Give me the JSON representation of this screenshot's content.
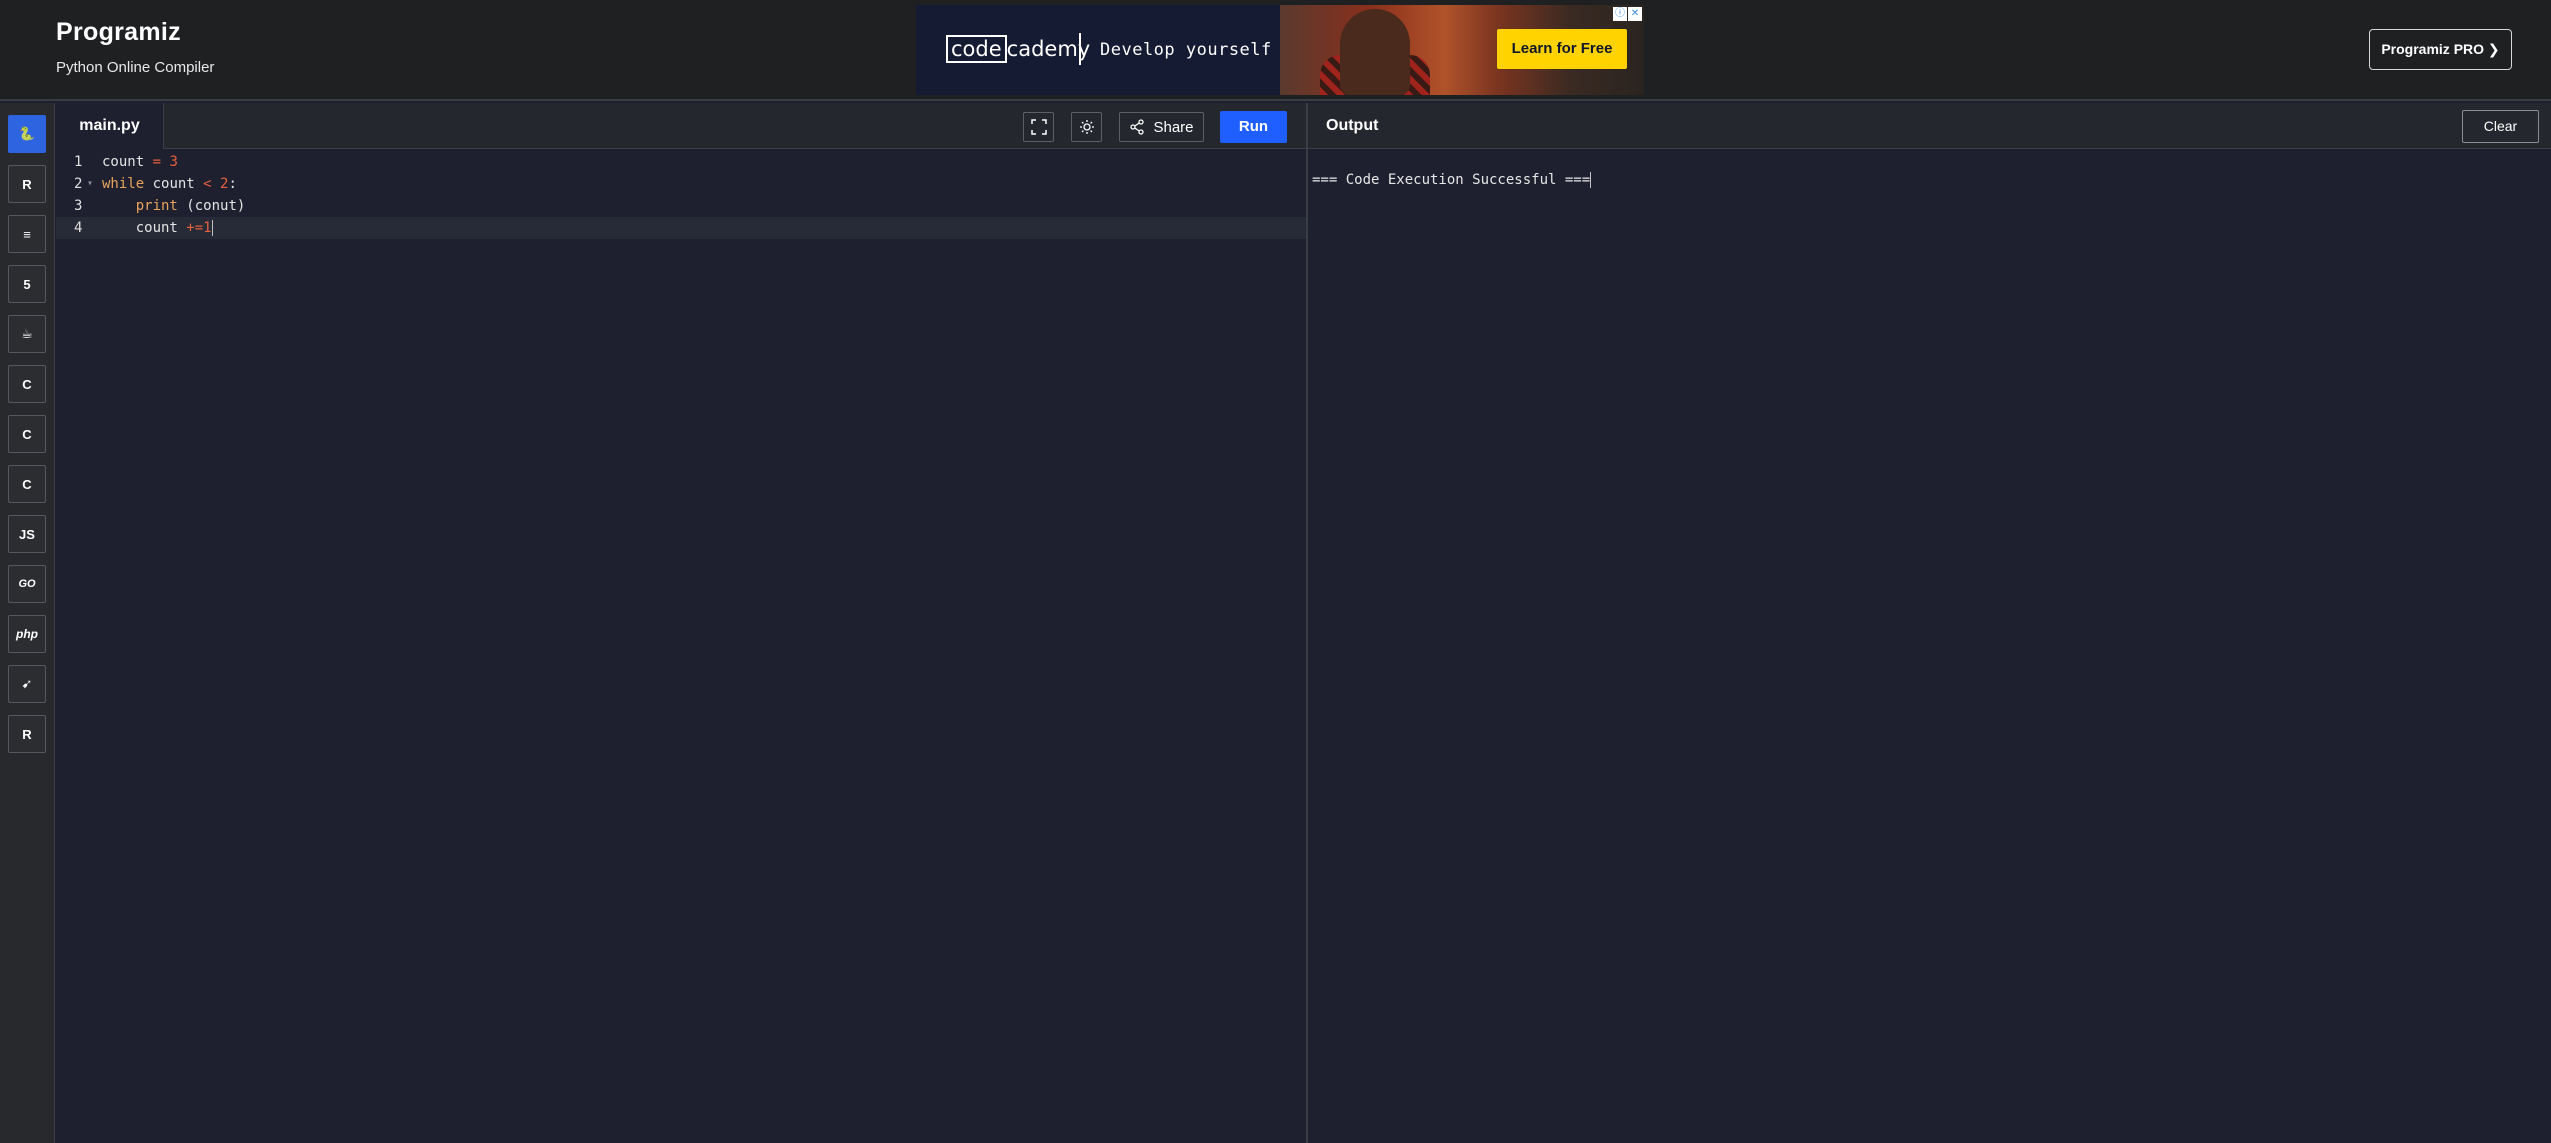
{
  "header": {
    "logo": "Programiz",
    "subtitle": "Python Online Compiler",
    "pro_button": "Programiz PRO ❯"
  },
  "ad": {
    "brand_left": "code",
    "brand_right": "cademy",
    "tagline": "Develop yourself",
    "cta": "Learn for Free",
    "choices_icon": "ⓘ",
    "close_icon": "✕"
  },
  "sidebar": {
    "languages": [
      {
        "name": "python",
        "glyph": "🐍",
        "active": true
      },
      {
        "name": "r",
        "glyph": "R"
      },
      {
        "name": "sql",
        "glyph": "≡"
      },
      {
        "name": "html",
        "glyph": "5"
      },
      {
        "name": "java",
        "glyph": "☕"
      },
      {
        "name": "c",
        "glyph": "C"
      },
      {
        "name": "cpp",
        "glyph": "C"
      },
      {
        "name": "csharp",
        "glyph": "C"
      },
      {
        "name": "js",
        "glyph": "JS"
      },
      {
        "name": "go",
        "glyph": "GO"
      },
      {
        "name": "php",
        "glyph": "php"
      },
      {
        "name": "swift",
        "glyph": "➹"
      },
      {
        "name": "rust",
        "glyph": "R"
      }
    ]
  },
  "editor": {
    "file_tab": "main.py",
    "share_label": "Share",
    "run_label": "Run",
    "lines": [
      {
        "num": "1",
        "tokens": [
          {
            "t": "count",
            "c": "id"
          },
          {
            "t": " = ",
            "c": "op"
          },
          {
            "t": "3",
            "c": "num"
          }
        ]
      },
      {
        "num": "2",
        "tokens": [
          {
            "t": "while",
            "c": "kw"
          },
          {
            "t": " count ",
            "c": "id"
          },
          {
            "t": "<",
            "c": "op"
          },
          {
            "t": " 2",
            "c": "num"
          },
          {
            "t": ":",
            "c": "id"
          }
        ]
      },
      {
        "num": "3",
        "tokens": [
          {
            "t": "    ",
            "c": "id"
          },
          {
            "t": "print",
            "c": "fn"
          },
          {
            "t": " (conut)",
            "c": "id"
          }
        ]
      },
      {
        "num": "4",
        "tokens": [
          {
            "t": "    count ",
            "c": "id"
          },
          {
            "t": "+=",
            "c": "op"
          },
          {
            "t": "1",
            "c": "num"
          }
        ]
      }
    ]
  },
  "output": {
    "title": "Output",
    "clear_label": "Clear",
    "text": "=== Code Execution Successful ==="
  },
  "colors": {
    "accent": "#1f5fff",
    "cta": "#ffd300",
    "background": "#1e2030"
  }
}
